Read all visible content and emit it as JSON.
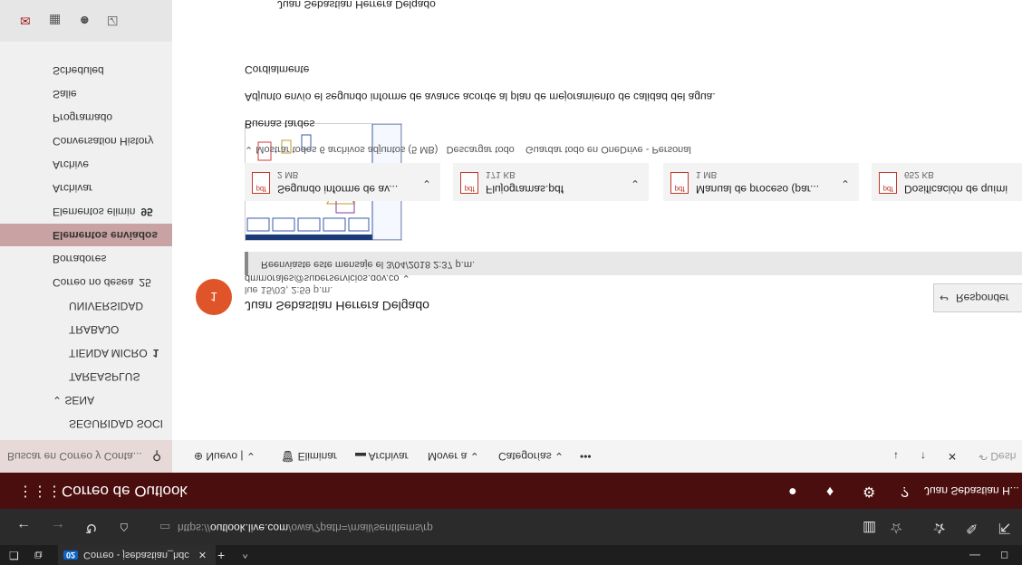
{
  "taskbar": {
    "tab_badge": "02",
    "tab_title": "Correo - jsebastian_hdc",
    "close": "✕",
    "new_tab": "+",
    "tabs_menu": "^"
  },
  "browser": {
    "url_prefix": "https://",
    "url_host": "outlook.live.com",
    "url_path": "/owa/?path=/mail/sentitems/rp"
  },
  "app": {
    "title": "Correo de Outlook",
    "user": "Juan Sebastian H..."
  },
  "search": {
    "placeholder": "Buscar en Correo y Conta..."
  },
  "commands": {
    "nuevo": "Nuevo",
    "eliminar": "Eliminar",
    "archivar": "Archivar",
    "mover": "Mover a",
    "categorias": "Categorías",
    "more": "•••",
    "deshacer": "Desh"
  },
  "nav": {
    "items": [
      {
        "label": "SEGURIDAD SOCI",
        "count": ""
      },
      {
        "label": "SENA",
        "count": ""
      },
      {
        "label": "TAREASPLUS",
        "count": ""
      },
      {
        "label": "TIENDA MICRO",
        "count": "1"
      },
      {
        "label": "TRABAJO",
        "count": ""
      },
      {
        "label": "UNIVERSIDAD",
        "count": ""
      },
      {
        "label": "Correo no desea",
        "count": "25"
      },
      {
        "label": "Borradores",
        "count": ""
      },
      {
        "label": "Elementos enviados",
        "count": ""
      },
      {
        "label": "Elementos elimin",
        "count": "95"
      },
      {
        "label": "Archivar",
        "count": ""
      },
      {
        "label": "Archive",
        "count": ""
      },
      {
        "label": "Conversation History",
        "count": ""
      },
      {
        "label": "Programado",
        "count": ""
      },
      {
        "label": "Salie",
        "count": ""
      },
      {
        "label": "Scheduled",
        "count": ""
      }
    ]
  },
  "message": {
    "avatar_number": "1",
    "sender": "Juan Sebastian Herrera Delgado",
    "date": "lue 15/03, 2:59 p.m.",
    "recipient": "dmmorales@superservicios.gov.co",
    "reply": "Responder",
    "forwarded": "Reenviaste este mensaje el 3/04/2018 2:37 p.m.",
    "attachments_header": "Mostrar todos 6 archivos adjuntos (5 MB)",
    "download_all": "Descargar todo",
    "save_onedrive": "Guardar todo en OneDrive - Personal",
    "greeting": "Buenas tardes",
    "body": "Adjunto envío el segundo informe de avance acorde al plan de mejoramiento de calidad del agua.",
    "closing": "Cordialmente",
    "signature": "Juan Sebastian Herrera Delgado",
    "attachments": [
      {
        "name": "Segundo informe de av...",
        "size": "2 MB"
      },
      {
        "name": "Flujogramas.pdf",
        "size": "171 KB"
      },
      {
        "name": "Manual de proceso (par...",
        "size": "1 MB"
      },
      {
        "name": "Dosificación de quími",
        "size": "652 KB"
      }
    ]
  }
}
